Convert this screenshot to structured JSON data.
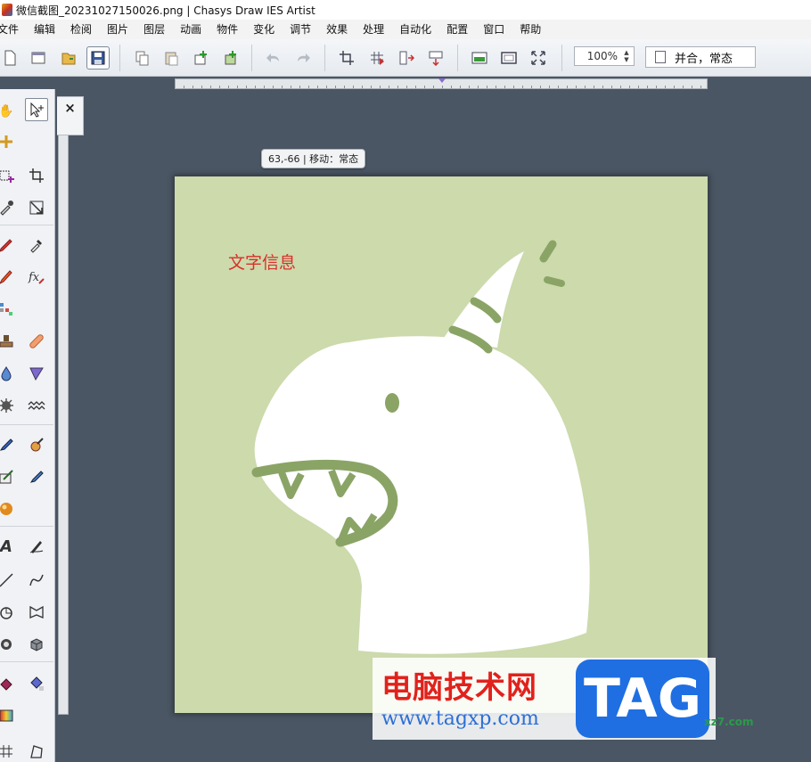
{
  "window": {
    "title": "微信截图_20231027150026.png | Chasys Draw IES Artist"
  },
  "menu": [
    "文件",
    "编辑",
    "检阅",
    "图片",
    "图层",
    "动画",
    "物件",
    "变化",
    "调节",
    "效果",
    "处理",
    "自动化",
    "配置",
    "窗口",
    "帮助"
  ],
  "toolbar": {
    "zoom_value": "100%",
    "zoom_spin_up": "▲",
    "zoom_spin_down": "▼",
    "mode_label": "并合，常态"
  },
  "status_tip": "63,-66 | 移动：常态",
  "panel": {
    "close_label": "×"
  },
  "canvas": {
    "text": "文字信息",
    "background": "#ccdaac",
    "figure_fill": "#ffffff",
    "figure_stroke": "#8aa466",
    "text_color": "#d8302a"
  },
  "watermark": {
    "site_name": "电脑技术网",
    "url": "www.tagxp.com",
    "tag": "TAG",
    "corner": "xz7.com"
  },
  "icons": {
    "toolbar": [
      "new-file-icon",
      "open-window-icon",
      "open-folder-icon",
      "save-icon",
      "copy-icon",
      "paste-icon",
      "add-layer-icon",
      "add-layer-alt-icon",
      "undo-icon",
      "redo-icon",
      "crop-icon",
      "grid-icon",
      "split-icon",
      "merge-icon",
      "image-icon",
      "frame-icon",
      "fullscreen-icon"
    ],
    "tools": [
      "hand-icon",
      "move-icon",
      "plus-icon",
      "select-rect-icon",
      "crop-tool-icon",
      "eyedropper-icon",
      "transform-icon",
      "pencil-icon",
      "dropper-icon",
      "brush-icon",
      "fx-icon",
      "pixel-icon",
      "stamp-icon",
      "bandage-icon",
      "drop-icon",
      "triangle-icon",
      "splat-icon",
      "wave-icon",
      "paintbrush-icon",
      "mixer-icon",
      "pen-card-icon",
      "pen-icon",
      "sphere-icon",
      "text-icon",
      "calligraphy-icon",
      "line-icon",
      "curve-icon",
      "circle-tool-icon",
      "warp-icon",
      "ring-icon",
      "cube-icon",
      "fill-icon",
      "bucket-icon",
      "gradient-icon",
      "grid-tool-icon",
      "perspective-icon"
    ]
  }
}
